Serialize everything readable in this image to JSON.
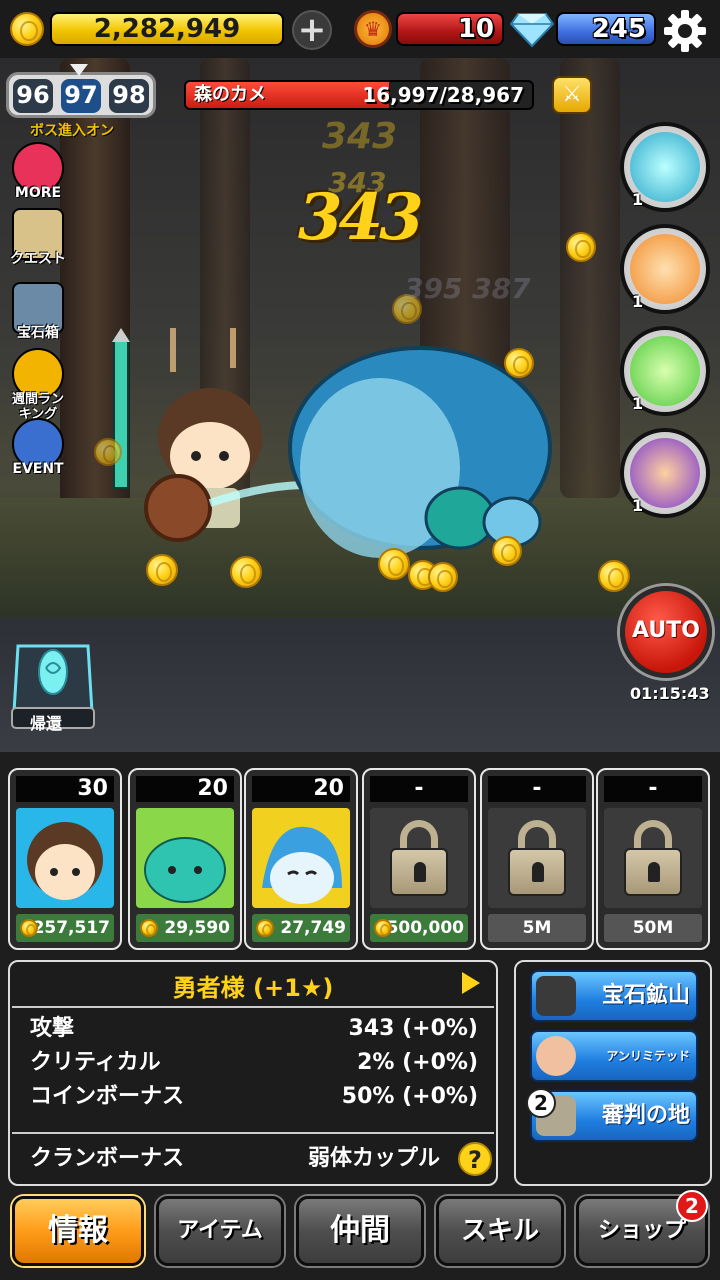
{
  "topbar": {
    "gold": "2,282,949",
    "rubies": "10",
    "gems": "245"
  },
  "stage": {
    "prev": "96",
    "current": "97",
    "next": "98",
    "boss_label": "ボス進入オン"
  },
  "boss": {
    "name": "森のカメ",
    "hp_text": "16,997/28,967",
    "hp_fraction": 0.587
  },
  "side_menu": [
    {
      "label": "MORE",
      "icon": "more-pig-icon",
      "color": "#e8325a"
    },
    {
      "label": "クエスト",
      "icon": "quest-scroll-icon",
      "color": "#d9c28a"
    },
    {
      "label": "宝石箱",
      "icon": "treasure-chest-icon",
      "color": "#6a8aa6"
    },
    {
      "label": "週間ランキング",
      "icon": "trophy-icon",
      "color": "#f2b400"
    },
    {
      "label": "EVENT",
      "icon": "thumbs-up-icon",
      "color": "#3a6fd0"
    }
  ],
  "return_label": "帰還",
  "damage": {
    "big": "343",
    "fade1": "343",
    "fade2": "343",
    "fade3": "395 387"
  },
  "skills": [
    {
      "level": "1",
      "color": "#2aa6c8"
    },
    {
      "level": "1",
      "color": "#f08a2a"
    },
    {
      "level": "1",
      "color": "#4ec83a"
    },
    {
      "level": "1",
      "color": "#7a3ad0"
    }
  ],
  "auto": {
    "label": "AUTO",
    "timer": "01:15:43"
  },
  "heroes": [
    {
      "level": "30",
      "price": "257,517",
      "locked": false,
      "color": "#29b6e8"
    },
    {
      "level": "20",
      "price": "29,590",
      "locked": false,
      "color": "#2fc4b0"
    },
    {
      "level": "20",
      "price": "27,749",
      "locked": false,
      "color": "#f2d020"
    },
    {
      "level": "-",
      "price": "500,000",
      "locked": true
    },
    {
      "level": "-",
      "price": "5M",
      "locked": true
    },
    {
      "level": "-",
      "price": "50M",
      "locked": true
    }
  ],
  "info": {
    "hero_name": "勇者様 (+1★)",
    "stats": [
      {
        "label": "攻撃",
        "value": "343 (+0%)"
      },
      {
        "label": "クリティカル",
        "value": "2% (+0%)"
      },
      {
        "label": "コインボーナス",
        "value": "50% (+0%)"
      }
    ],
    "clan_label": "クランボーナス",
    "clan_value": "弱体カップル",
    "help": "?"
  },
  "modes": [
    {
      "label": "宝石鉱山",
      "icon": "mine-icon"
    },
    {
      "label": "アンリミテッド",
      "icon": "tap-finger-icon"
    },
    {
      "label": "審判の地",
      "icon": "colosseum-icon",
      "badge": "2"
    }
  ],
  "nav": {
    "info": "情報",
    "item": "アイテム",
    "friends": "仲間",
    "skill": "スキル",
    "shop": "ショップ",
    "shop_badge": "2"
  }
}
